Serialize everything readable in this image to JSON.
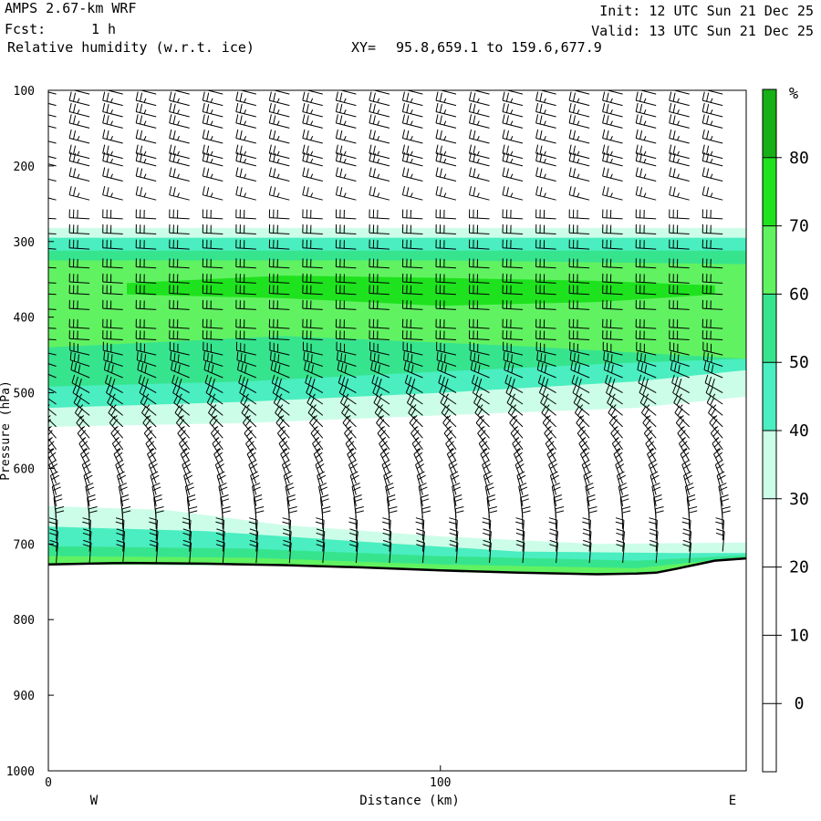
{
  "header": {
    "model": "AMPS 2.67-km WRF",
    "fcst_label": "Fcst:",
    "fcst_value": "1 h",
    "field": "Relative humidity (w.r.t. ice)",
    "xy_label": "XY=",
    "xy_value": "95.8,659.1 to 159.6,677.9",
    "init": "Init: 12 UTC Sun 21 Dec 25",
    "valid": "Valid: 13 UTC Sun 21 Dec 25"
  },
  "chart_data": {
    "type": "heatmap",
    "xlabel": "Distance (km)",
    "ylabel": "Pressure (hPa)",
    "xlim": [
      0,
      178
    ],
    "ylim": [
      1000,
      100
    ],
    "x_ticks": [
      0,
      100
    ],
    "y_ticks": [
      100,
      200,
      300,
      400,
      500,
      600,
      700,
      800,
      900,
      1000
    ],
    "x_end_labels": [
      "W",
      "E"
    ],
    "colorbar": {
      "unit": "%",
      "levels": [
        -10,
        0,
        10,
        20,
        30,
        40,
        50,
        60,
        70,
        80,
        90
      ],
      "tick_labels": [
        0,
        10,
        20,
        30,
        40,
        50,
        60,
        70,
        80
      ],
      "colors": [
        "#ffffff",
        "#ffffff",
        "#ffffff",
        "#ffffff",
        "#ccfde8",
        "#4aeec0",
        "#37e48e",
        "#61f261",
        "#1ee21e",
        "#16b016"
      ]
    },
    "rh_layers": [
      {
        "level_range": [
          30,
          40
        ],
        "color": "#ccfde8",
        "top": [
          [
            0,
            545
          ],
          [
            50,
            540
          ],
          [
            100,
            530
          ],
          [
            150,
            520
          ],
          [
            178,
            505
          ]
        ],
        "bottom": [
          [
            0,
            282
          ],
          [
            178,
            282
          ]
        ]
      },
      {
        "level_range": [
          40,
          50
        ],
        "color": "#4aeec0",
        "top": [
          [
            0,
            520
          ],
          [
            50,
            512
          ],
          [
            100,
            500
          ],
          [
            150,
            485
          ],
          [
            178,
            470
          ]
        ],
        "bottom": [
          [
            0,
            295
          ],
          [
            178,
            295
          ]
        ]
      },
      {
        "level_range": [
          50,
          60
        ],
        "color": "#37e48e",
        "top": [
          [
            0,
            492
          ],
          [
            50,
            485
          ],
          [
            100,
            472
          ],
          [
            150,
            460
          ],
          [
            178,
            455
          ]
        ],
        "bottom": [
          [
            0,
            312
          ],
          [
            178,
            312
          ]
        ]
      },
      {
        "level_range": [
          60,
          70
        ],
        "color": "#61f261",
        "top": [
          [
            0,
            440
          ],
          [
            60,
            425
          ],
          [
            120,
            438
          ],
          [
            178,
            455
          ]
        ],
        "bottom": [
          [
            0,
            325
          ],
          [
            100,
            325
          ],
          [
            178,
            330
          ]
        ]
      },
      {
        "level_range": [
          70,
          80
        ],
        "color": "#1ee21e",
        "top": [
          [
            20,
            370
          ],
          [
            60,
            375
          ],
          [
            100,
            385
          ],
          [
            140,
            380
          ],
          [
            170,
            370
          ]
        ],
        "bottom": [
          [
            20,
            355
          ],
          [
            60,
            345
          ],
          [
            100,
            348
          ],
          [
            140,
            352
          ],
          [
            170,
            358
          ]
        ]
      },
      {
        "level_range": [
          30,
          40
        ],
        "color": "#ccfde8",
        "top": [
          [
            0,
            650
          ],
          [
            30,
            655
          ],
          [
            60,
            675
          ],
          [
            100,
            690
          ],
          [
            140,
            700
          ],
          [
            178,
            698
          ]
        ],
        "bottom": [
          [
            0,
            727
          ],
          [
            60,
            728
          ],
          [
            100,
            735
          ],
          [
            140,
            740
          ],
          [
            155,
            738
          ],
          [
            170,
            722
          ],
          [
            178,
            719
          ]
        ]
      },
      {
        "level_range": [
          40,
          50
        ],
        "color": "#4aeec0",
        "top": [
          [
            0,
            677
          ],
          [
            40,
            683
          ],
          [
            80,
            697
          ],
          [
            120,
            710
          ],
          [
            160,
            712
          ],
          [
            178,
            712
          ]
        ],
        "bottom": [
          [
            0,
            727
          ],
          [
            60,
            728
          ],
          [
            100,
            735
          ],
          [
            140,
            740
          ],
          [
            155,
            738
          ],
          [
            170,
            722
          ],
          [
            178,
            719
          ]
        ]
      },
      {
        "level_range": [
          50,
          60
        ],
        "color": "#37e48e",
        "top": [
          [
            0,
            703
          ],
          [
            50,
            706
          ],
          [
            100,
            716
          ],
          [
            150,
            722
          ],
          [
            178,
            715
          ]
        ],
        "bottom": [
          [
            0,
            727
          ],
          [
            60,
            728
          ],
          [
            100,
            735
          ],
          [
            140,
            740
          ],
          [
            155,
            738
          ],
          [
            170,
            722
          ],
          [
            178,
            719
          ]
        ]
      },
      {
        "level_range": [
          60,
          70
        ],
        "color": "#61f261",
        "top": [
          [
            0,
            716
          ],
          [
            50,
            718
          ],
          [
            100,
            727
          ],
          [
            150,
            732
          ],
          [
            178,
            717
          ]
        ],
        "bottom": [
          [
            0,
            727
          ],
          [
            60,
            728
          ],
          [
            100,
            735
          ],
          [
            140,
            740
          ],
          [
            155,
            738
          ],
          [
            170,
            722
          ],
          [
            178,
            719
          ]
        ]
      }
    ],
    "terrain": {
      "surface_pressure": [
        [
          0,
          727
        ],
        [
          20,
          725
        ],
        [
          40,
          726
        ],
        [
          60,
          728
        ],
        [
          80,
          731
        ],
        [
          100,
          735
        ],
        [
          120,
          738
        ],
        [
          140,
          740
        ],
        [
          150,
          739
        ],
        [
          155,
          738
        ],
        [
          160,
          733
        ],
        [
          170,
          722
        ],
        [
          178,
          719
        ]
      ]
    },
    "wind_barbs": {
      "columns_x": [
        2,
        10.5,
        19,
        27.5,
        36,
        44.5,
        53,
        61.5,
        70,
        78.5,
        87,
        95.5,
        104,
        112.5,
        121,
        129.5,
        138,
        146.5,
        155,
        163.5,
        172
      ],
      "levels_hpa": [
        105,
        120,
        135,
        150,
        170,
        190,
        200,
        220,
        245,
        270,
        290,
        310,
        335,
        355,
        370,
        390,
        415,
        430,
        450,
        465,
        480,
        500,
        515,
        530,
        545,
        560,
        575,
        590,
        605,
        620,
        635,
        650,
        665,
        680,
        695,
        710,
        725
      ],
      "profile": [
        {
          "p": 100,
          "kt": 25
        },
        {
          "p": 200,
          "kt": 25
        },
        {
          "p": 260,
          "kt": 30
        },
        {
          "p": 300,
          "kt": 30
        },
        {
          "p": 400,
          "kt": 30
        },
        {
          "p": 500,
          "kt": 30
        },
        {
          "p": 600,
          "kt": 25
        },
        {
          "p": 700,
          "kt": 20
        },
        {
          "p": 730,
          "kt": 20
        }
      ]
    }
  }
}
